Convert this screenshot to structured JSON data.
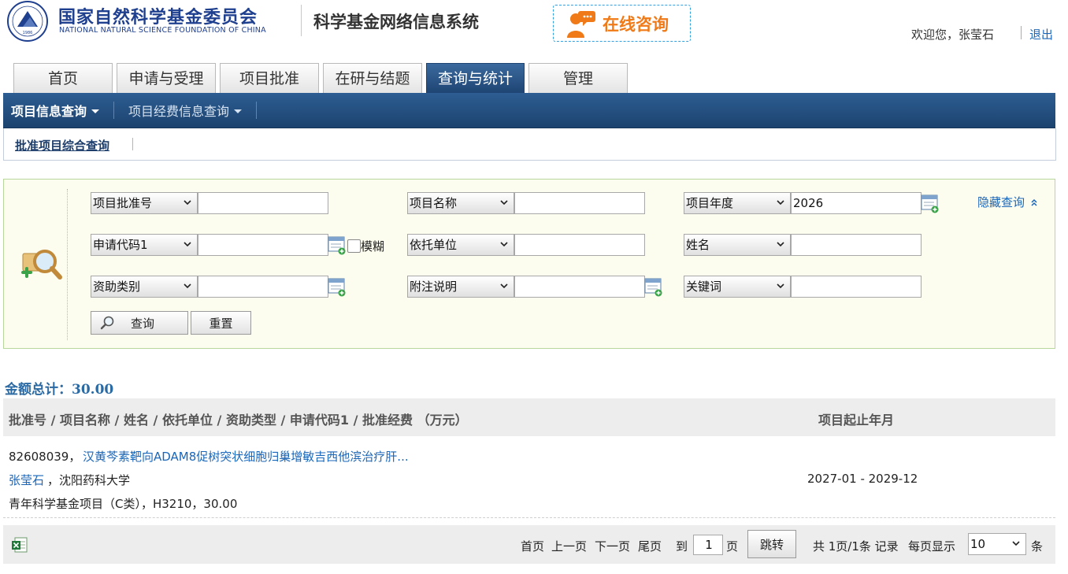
{
  "header": {
    "org_name_cn": "国家自然科学基金委员会",
    "org_name_en": "NATIONAL NATURAL SCIENCE FOUNDATION OF CHINA",
    "system_title": "科学基金网络信息系统",
    "consult_label": "在线咨询",
    "welcome_text": "欢迎您，张莹石",
    "logout_label": "退出",
    "logo_year": "1986"
  },
  "tabs": [
    {
      "label": "首页",
      "active": false
    },
    {
      "label": "申请与受理",
      "active": false
    },
    {
      "label": "项目批准",
      "active": false
    },
    {
      "label": "在研与结题",
      "active": false
    },
    {
      "label": "查询与统计",
      "active": true
    },
    {
      "label": "管理",
      "active": false
    }
  ],
  "menubar": {
    "items": [
      {
        "label": "项目信息查询",
        "active": true
      },
      {
        "label": "项目经费信息查询",
        "active": false
      }
    ]
  },
  "subbar": {
    "link_label": "批准项目综合查询"
  },
  "query": {
    "hide_label": "隐藏查询",
    "fields": {
      "approval_no": {
        "select": "项目批准号",
        "value": ""
      },
      "project_name": {
        "select": "项目名称",
        "value": ""
      },
      "project_year": {
        "select": "项目年度",
        "value": "2026"
      },
      "apply_code": {
        "select": "申请代码1",
        "value": ""
      },
      "fuzzy_label": "模糊",
      "unit": {
        "select": "依托单位",
        "value": ""
      },
      "person_name": {
        "select": "姓名",
        "value": ""
      },
      "funding_type": {
        "select": "资助类别",
        "value": ""
      },
      "note": {
        "select": "附注说明",
        "value": ""
      },
      "keyword": {
        "select": "关键词",
        "value": ""
      }
    },
    "search_label": "查询",
    "reset_label": "重置"
  },
  "results": {
    "total_label": "金额总计：",
    "total_value": "30.00",
    "header_left": "批准号 / 项目名称 / 姓名 / 依托单位 / 资助类型 / 申请代码1 / 批准经费 （万元）",
    "header_right": "项目起止年月",
    "rows": [
      {
        "approval_no": "82608039，",
        "project_name": "汉黄芩素靶向ADAM8促树突状细胞归巢增敏吉西他滨治疗肝...",
        "person": "张莹石",
        "unit": "，沈阳药科大学",
        "funding_line": "青年科学基金项目（C类），H3210，30.00",
        "period": "2027-01 - 2029-12"
      }
    ]
  },
  "pager": {
    "first": "首页",
    "prev": "上一页",
    "next": "下一页",
    "last": "尾页",
    "goto_label": "到",
    "page_value": "1",
    "page_unit": "页",
    "jump_label": "跳转",
    "summary": "共 1页/1条 记录",
    "per_page_label": "每页显示",
    "per_page_value": "10",
    "per_page_unit": "条"
  },
  "colors": {
    "brand_blue": "#1f3f8f",
    "menubar_blue": "#1c436f",
    "consult_orange": "#f07a17",
    "link_blue": "#1a66b8",
    "query_bg": "#fcfcef"
  },
  "icons": [
    "nsfc-emblem-icon",
    "consult-chat-icon",
    "search-magnifier-icon",
    "calendar-picker-icon",
    "double-chevron-up-icon",
    "excel-export-icon",
    "chevron-down-icon"
  ]
}
